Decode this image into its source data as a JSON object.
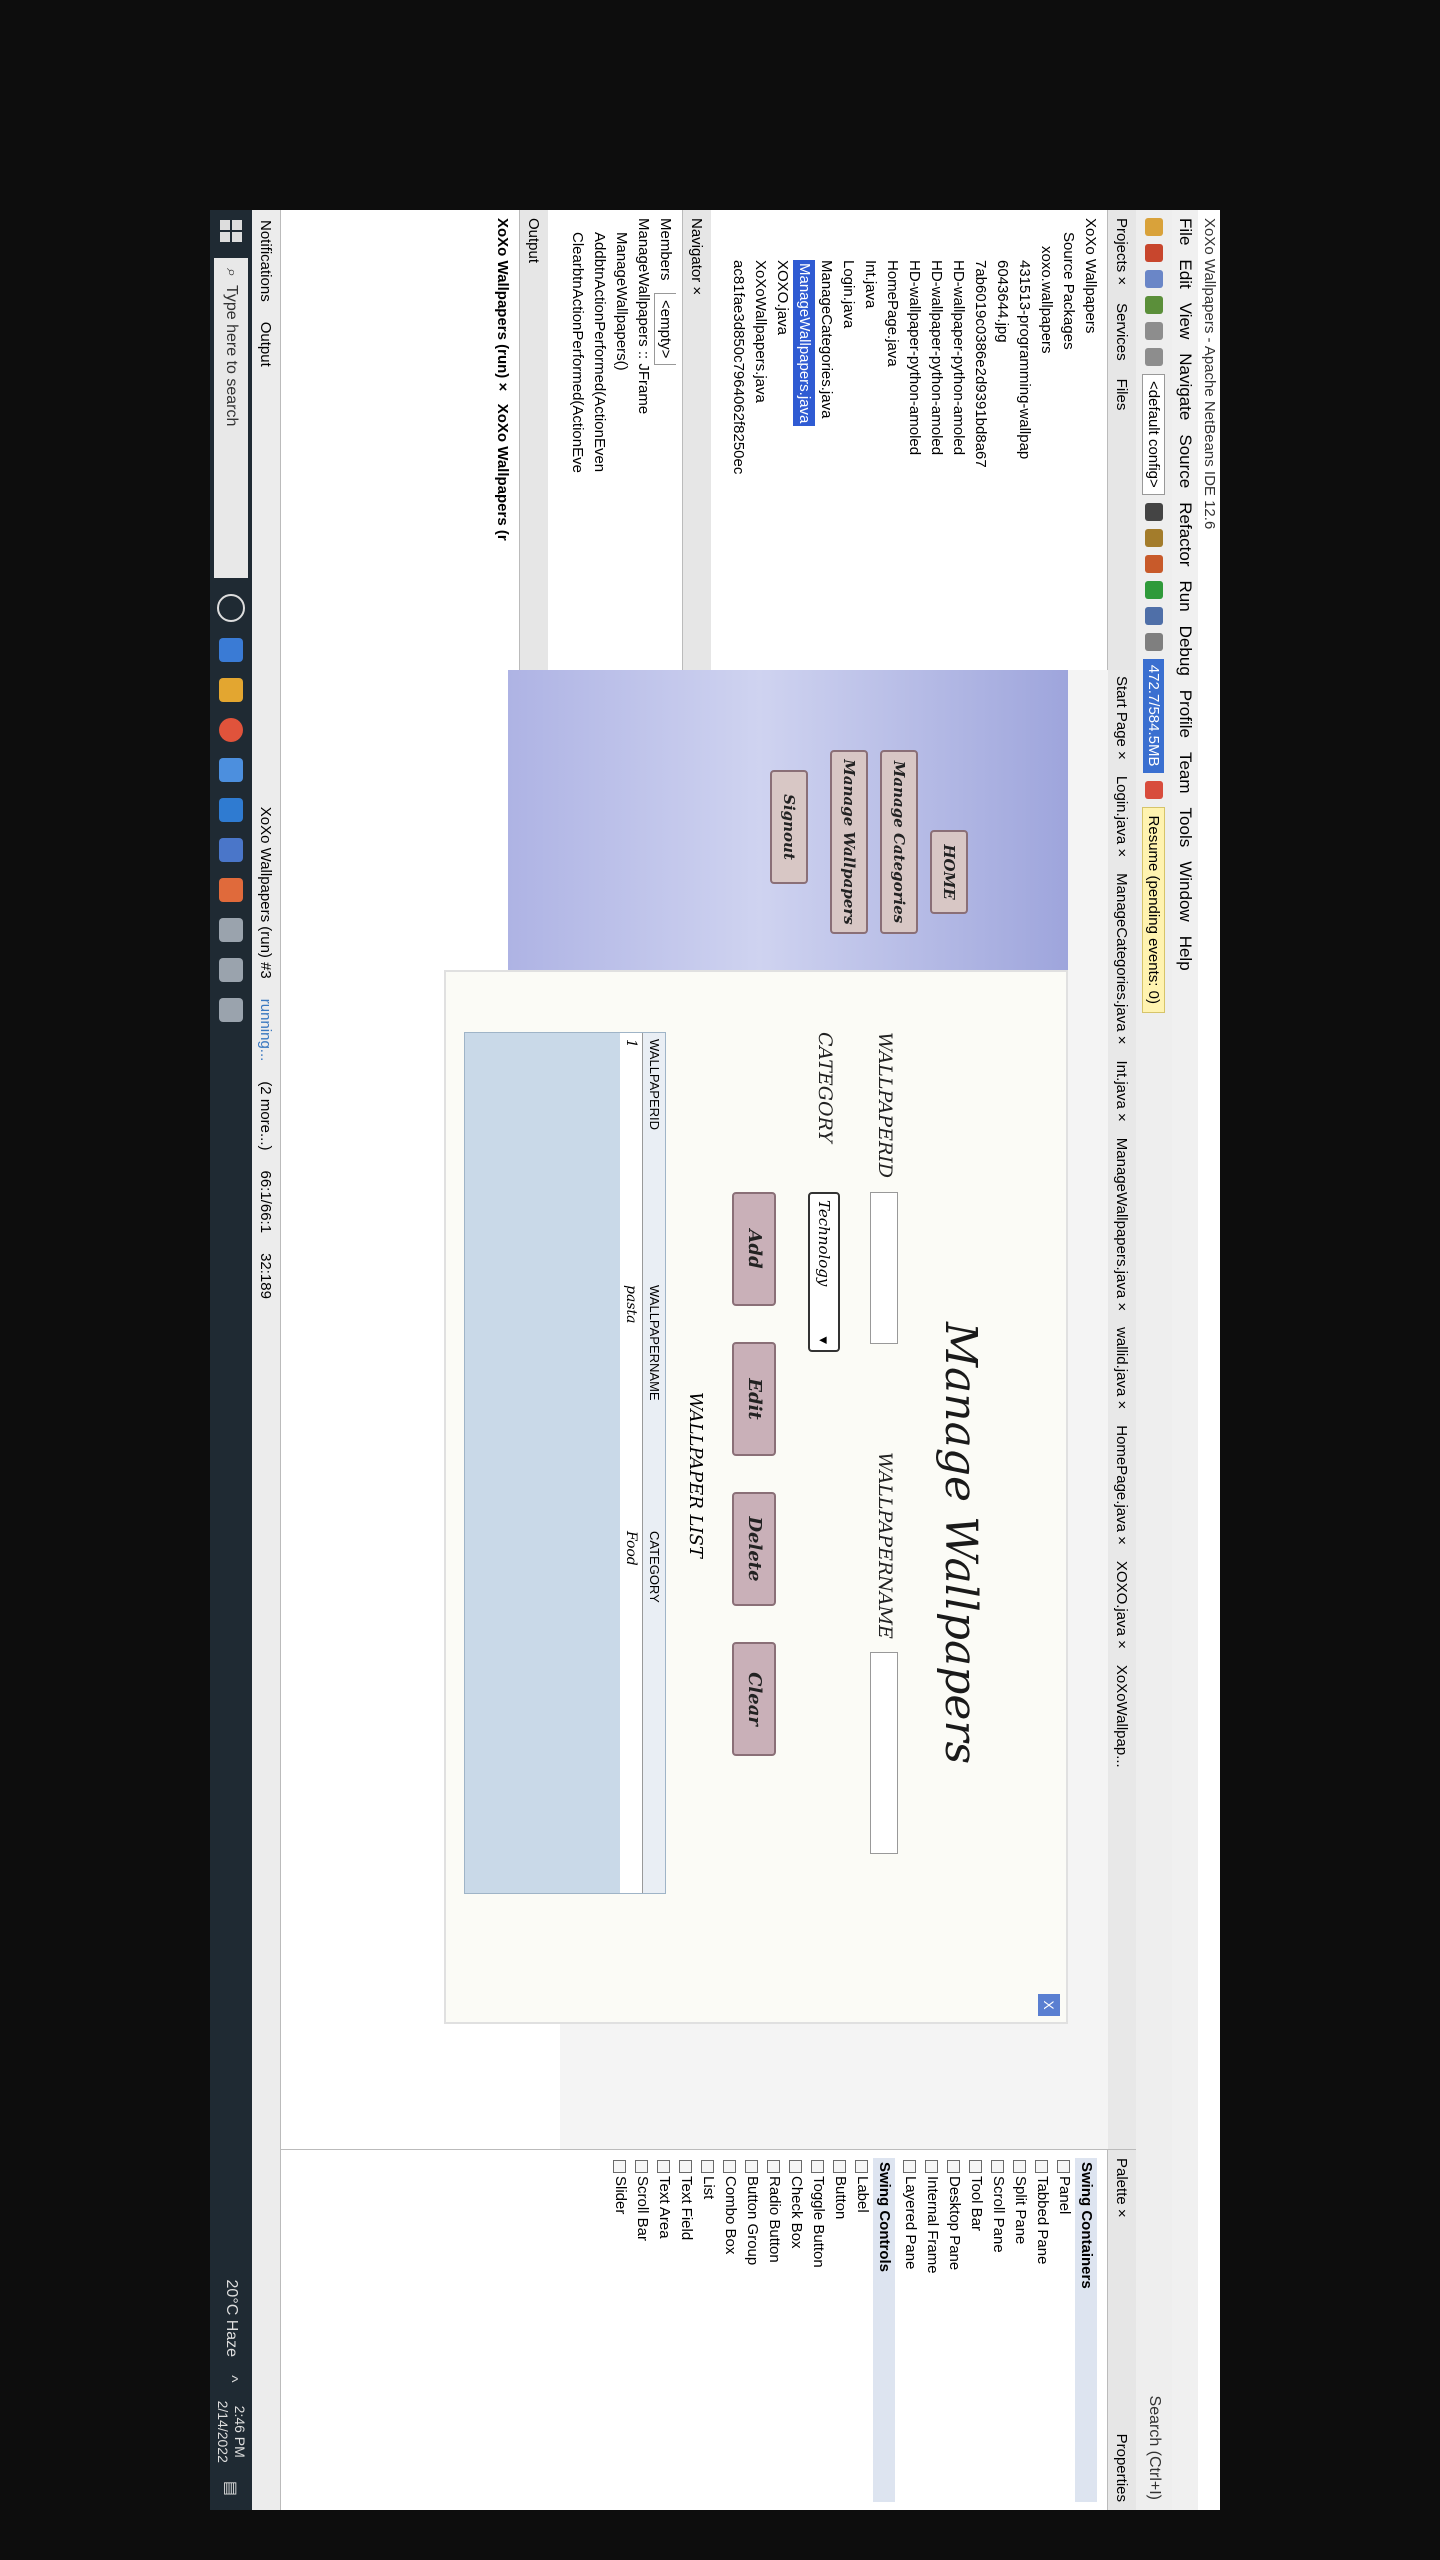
{
  "window": {
    "title": "XoXo Wallpapers - Apache NetBeans IDE 12.6"
  },
  "menu": [
    "File",
    "Edit",
    "View",
    "Navigate",
    "Source",
    "Refactor",
    "Run",
    "Debug",
    "Profile",
    "Team",
    "Tools",
    "Window",
    "Help"
  ],
  "toolbar": {
    "config": "<default config>",
    "memory": "472.7/584.5MB",
    "resume": "Resume (pending events: 0)",
    "search": "Search (Ctrl+I)"
  },
  "left_panel": {
    "tabs": [
      "Projects ×",
      "Services",
      "Files"
    ],
    "tree": [
      "XoXo Wallpapers",
      "Source Packages",
      "xoxo.wallpapers",
      "431513-programming-wallpap",
      "6043644.jpg",
      "7ab6019c0386e2d9391bd8a67",
      "HD-wallpaper-python-amoled",
      "HD-wallpaper-python-amoled",
      "HD-wallpaper-python-amoled",
      "HomePage.java",
      "Int.java",
      "Login.java",
      "ManageCategories.java",
      "ManageWallpapers.java",
      "XOXO.java",
      "XoXoWallpapers.java",
      "ac81fae3d850c7964062f8250ec"
    ],
    "selected": "ManageWallpapers.java",
    "navigator": {
      "tab": "Navigator ×",
      "members": "Members",
      "filter": "<empty>",
      "items": [
        "ManageWallpapers :: JFrame",
        "ManageWallpapers()",
        "AddbtnActionPerformed(ActionEven",
        "ClearbtnActionPerformed(ActionEve"
      ]
    },
    "output": {
      "label": "Output",
      "tabs": [
        "XoXo Wallpapers (run) ×",
        "XoXo Wallpapers (r"
      ]
    }
  },
  "editor": {
    "tabs": [
      "Start Page ×",
      "Login.java ×",
      "ManageCategories.java ×",
      "Int.java ×",
      "ManageWallpapers.java ×",
      "wallid.java ×",
      "HomePage.java ×",
      "XOXO.java ×",
      "XoXoWallpap..."
    ],
    "form": {
      "title": "Manage Wallpapers",
      "side_buttons": [
        "HOME",
        "Manage Categories",
        "Manage Wallpapers",
        "Signout"
      ],
      "labels": {
        "wallpaper_id": "WALLPAPERID",
        "wallpaper_name": "WALLPAPERNAME",
        "category": "CATEGORY"
      },
      "category_value": "Technology",
      "buttons": {
        "add": "Add",
        "edit": "Edit",
        "delete": "Delete",
        "clear": "Clear"
      },
      "list_title": "WALLPAPER LIST",
      "table": {
        "columns": [
          "WALLPAPERID",
          "WALLPAPERNAME",
          "CATEGORY"
        ],
        "rows": [
          [
            "1",
            "pasta",
            "Food"
          ]
        ]
      },
      "close": "X"
    }
  },
  "palette": {
    "tab": "Palette ×",
    "groups": [
      {
        "name": "Swing Containers",
        "items": [
          "Panel",
          "Tabbed Pane",
          "Split Pane",
          "Scroll Pane",
          "Tool Bar",
          "Desktop Pane",
          "Internal Frame",
          "Layered Pane"
        ]
      },
      {
        "name": "Swing Controls",
        "items": [
          "Label",
          "Button",
          "Toggle Button",
          "Check Box",
          "Radio Button",
          "Button Group",
          "Combo Box",
          "List",
          "Text Field",
          "Text Area",
          "Scroll Bar",
          "Slider"
        ]
      }
    ],
    "properties": "Properties"
  },
  "status": {
    "run": "XoXo Wallpapers (run) #3",
    "running": "running...",
    "more": "(2 more...)",
    "position": "66:1/66:1",
    "pos2": "32:189"
  },
  "taskbar": {
    "search": "Type here to search",
    "weather": "20°C Haze",
    "time": "2:46 PM",
    "date": "2/14/2022",
    "notifications": "Notifications",
    "output_btn": "Output"
  },
  "colors": {
    "frame_gradient_top": "#9ea5dc",
    "button_fill": "#c9b0b8",
    "table_bg": "#c9d9e8",
    "selection": "#2f5bd3"
  }
}
